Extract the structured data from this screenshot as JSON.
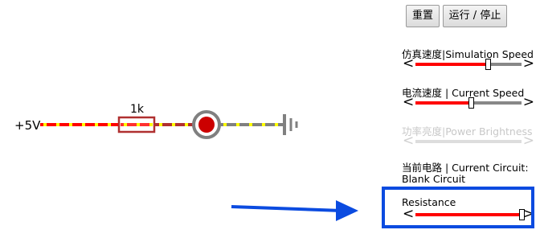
{
  "buttons": {
    "reset_label": "重置",
    "run_label": "运行 / 停止"
  },
  "controls": {
    "simulation_speed": {
      "label": "仿真速度|Simulation Speed",
      "value": 0.68,
      "enabled": true
    },
    "current_speed": {
      "label": "电流速度 | Current Speed",
      "value": 0.52,
      "enabled": true
    },
    "power_brightness": {
      "label": "功率亮度|Power Brightness",
      "value": null,
      "enabled": false
    },
    "resistance": {
      "label": "Resistance",
      "value": 1.0,
      "enabled": true
    }
  },
  "current_circuit": {
    "label": "当前电路 | Current Circuit:",
    "name": "Blank Circuit"
  },
  "circuit": {
    "source_label": "+5V",
    "resistor_label": "1k",
    "wire_color_high": "#ff0000",
    "wire_color_low": "#808080",
    "current_dot_color": "#ffff00",
    "led_color": "#cc0000"
  },
  "annotation": {
    "arrow_color": "#0b4be0",
    "highlight_color": "#0b4be0"
  },
  "icons": {
    "arrow_left": "<",
    "arrow_right": ">"
  }
}
